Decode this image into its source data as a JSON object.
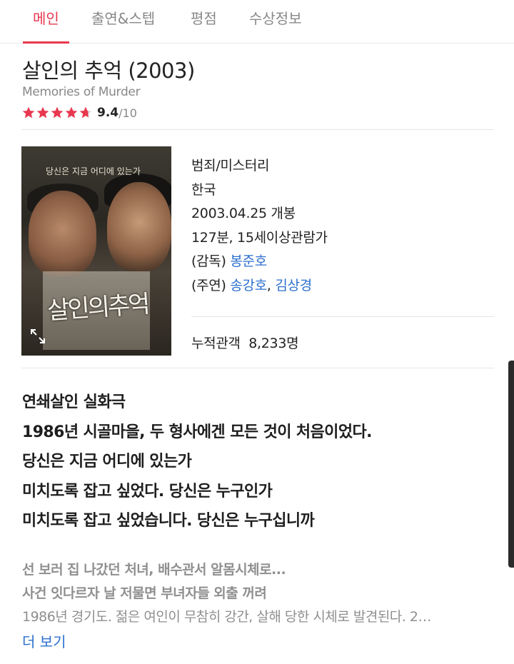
{
  "tabs": [
    {
      "label": "메인",
      "active": true
    },
    {
      "label": "출연&스텝",
      "active": false
    },
    {
      "label": "평점",
      "active": false
    },
    {
      "label": "수상정보",
      "active": false
    }
  ],
  "movie": {
    "title": "살인의 추억 (2003)",
    "original_title": "Memories of Murder",
    "rating": {
      "score": "9.4",
      "max": "/10",
      "stars_filled": 4.7
    },
    "poster": {
      "tagline": "당신은 지금 어디에 있는가",
      "calligraphy": "살인의추억",
      "expand_icon": "expand-icon"
    },
    "info": {
      "genre": "범죄/미스터리",
      "country": "한국",
      "release": "2003.04.25 개봉",
      "runtime_rating": "127분, 15세이상관람가",
      "director_prefix": "(감독) ",
      "director": "봉준호",
      "cast_prefix": "(주연) ",
      "cast1": "송강호",
      "cast_sep": ", ",
      "cast2": "김상경",
      "audience_label": "누적관객",
      "audience_value": "8,233명"
    },
    "synopsis_headlines": [
      "연쇄살인 실화극",
      "1986년 시골마을, 두 형사에겐 모든 것이 처음이었다.",
      "당신은 지금 어디에 있는가",
      "미치도록 잡고 싶었다. 당신은 누구인가",
      "미치도록 잡고 싶었습니다. 당신은 누구십니까"
    ],
    "description": [
      "선 보러 집 나갔던 처녀, 배수관서 알몸시체로...",
      "사건 잇다르자 날 저물면 부녀자들 외출 꺼려",
      "1986년 경기도. 젊은 여인이 무참히 강간, 살해 당한 시체로 발견된다. 2…"
    ],
    "more_label": "더 보기"
  },
  "colors": {
    "accent": "#e8384f",
    "link": "#2c6fcf",
    "muted": "#888888"
  }
}
